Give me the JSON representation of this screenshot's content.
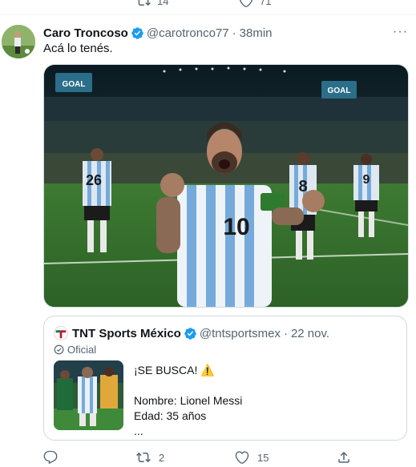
{
  "prev_actions": {
    "retweets": "14",
    "likes": "71"
  },
  "tweet": {
    "author_name": "Caro Troncoso",
    "handle": "@carotronco77",
    "separator": "·",
    "time": "38min",
    "more": "···",
    "text": "Acá lo tenés.",
    "media_description_jerseys": [
      "26",
      "10",
      "8",
      "9"
    ],
    "stadium_sign": "GOAL"
  },
  "quote": {
    "author_name": "TNT Sports México",
    "handle": "@tntsportsmex",
    "separator": "·",
    "date": "22 nov.",
    "badge": "Oficial",
    "lines": [
      "¡SE BUSCA! ⚠️",
      "",
      "Nombre: Lionel Messi",
      "Edad: 35 años",
      "..."
    ]
  },
  "actions": {
    "reply": "",
    "retweets": "2",
    "likes": "15",
    "share": ""
  },
  "colors": {
    "muted": "#536471",
    "verified": "#1d9bf0",
    "border": "#cfd9de",
    "arg_blue": "#75aadb"
  }
}
